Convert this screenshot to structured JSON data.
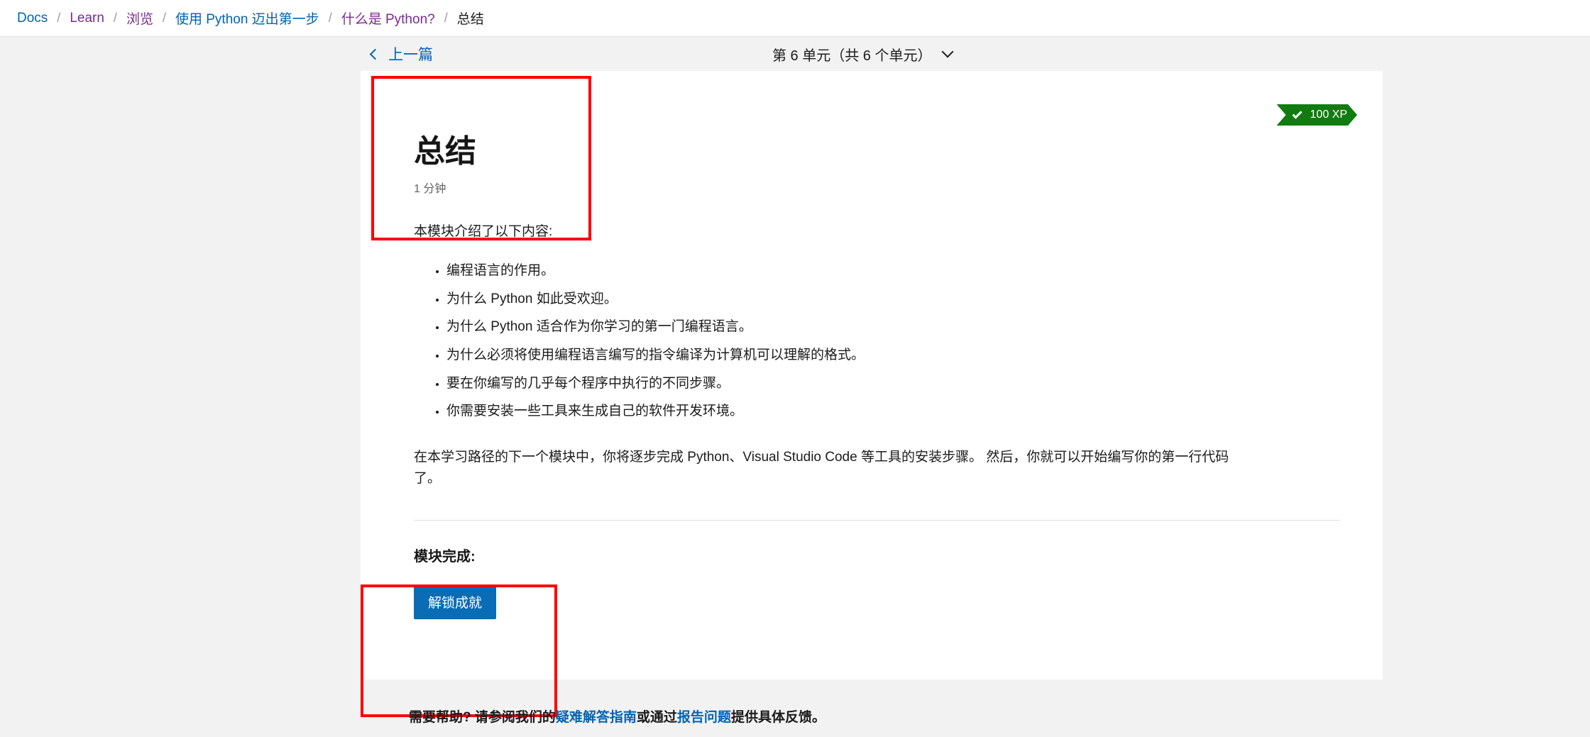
{
  "breadcrumb": {
    "separator": "/",
    "items": [
      {
        "label": "Docs",
        "style": "blue",
        "current": false
      },
      {
        "label": "Learn",
        "style": "purple",
        "current": false
      },
      {
        "label": "浏览",
        "style": "purple",
        "current": false
      },
      {
        "label": "使用 Python 迈出第一步",
        "style": "blue",
        "current": false
      },
      {
        "label": "什么是 Python?",
        "style": "purple",
        "current": false
      },
      {
        "label": "总结",
        "style": "current",
        "current": true
      }
    ]
  },
  "unit_nav": {
    "previous_label": "上一篇",
    "previous_icon": "chevron-left-icon",
    "unit_selector_label": "第 6 单元（共 6 个单元）",
    "unit_selector_icon": "chevron-down-icon",
    "current_unit": 6,
    "total_units": 6
  },
  "xp_badge": {
    "label": "100 XP",
    "icon": "check-icon",
    "color": "#107c10",
    "amount": 100
  },
  "unit": {
    "title": "总结",
    "read_time": "1 分钟",
    "intro": "本模块介绍了以下内容:",
    "bullets": [
      "编程语言的作用。",
      "为什么 Python 如此受欢迎。",
      "为什么 Python 适合作为你学习的第一门编程语言。",
      "为什么必须将使用编程语言编写的指令编译为计算机可以理解的格式。",
      "要在你编写的几乎每个程序中执行的不同步骤。",
      "你需要安装一些工具来生成自己的软件开发环境。"
    ],
    "closing_paragraph": "在本学习路径的下一个模块中，你将逐步完成 Python、Visual Studio Code 等工具的安装步骤。 然后，你就可以开始编写你的第一行代码了。"
  },
  "completion": {
    "heading": "模块完成:",
    "button_label": "解锁成就",
    "button_color": "#0a6cb5"
  },
  "footer": {
    "prefix": "需要帮助? 请参阅我们的",
    "link1": "疑难解答指南",
    "middle": "或通过",
    "link2": "报告问题",
    "suffix": "提供具体反馈。"
  },
  "annotations": {
    "color": "#fe0000",
    "boxes": [
      "title-region",
      "module-completion-region"
    ]
  }
}
